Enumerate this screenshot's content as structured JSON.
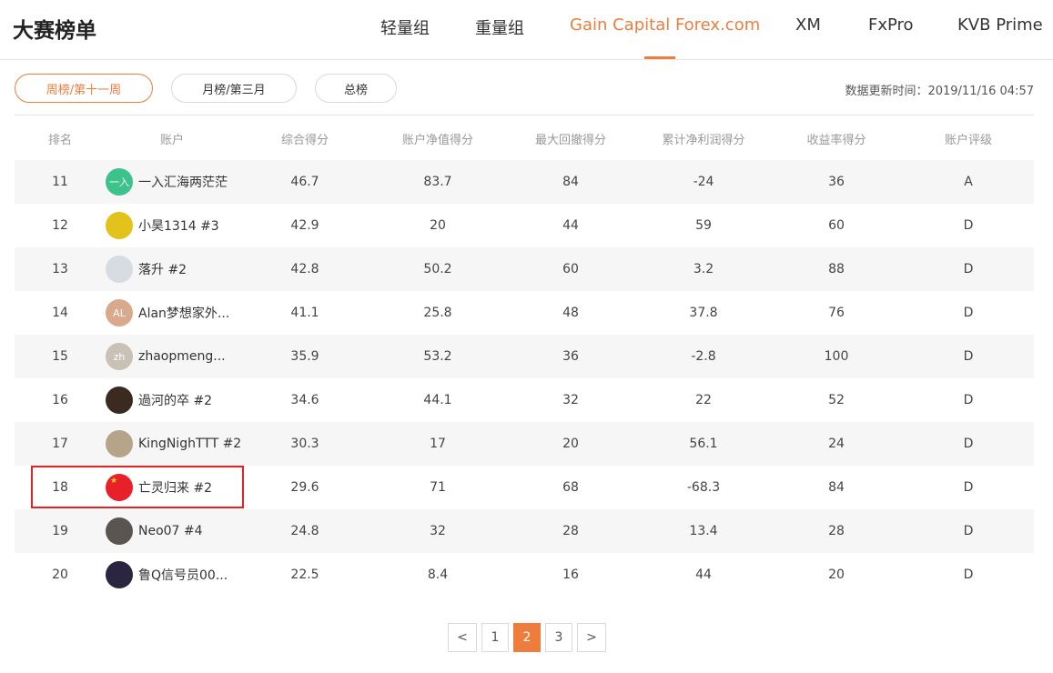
{
  "header": {
    "title": "大赛榜单",
    "tabs": [
      {
        "label": "轻量组",
        "active": false
      },
      {
        "label": "重量组",
        "active": false
      },
      {
        "label": "Gain Capital Forex.com",
        "active": true
      },
      {
        "label": "XM",
        "active": false
      },
      {
        "label": "FxPro",
        "active": false
      },
      {
        "label": "KVB Prime",
        "active": false
      }
    ]
  },
  "filters": [
    {
      "label": "周榜/第十一周",
      "active": true
    },
    {
      "label": "月榜/第三月",
      "active": false
    },
    {
      "label": "总榜",
      "active": false
    }
  ],
  "update_time": "数据更新时间：2019/11/16 04:57",
  "table": {
    "columns": [
      "排名",
      "账户",
      "综合得分",
      "账户净值得分",
      "最大回撤得分",
      "累计净利润得分",
      "收益率得分",
      "账户评级"
    ],
    "rows": [
      {
        "rank": "11",
        "avatar_text": "一入",
        "avatar_color": "#3cc28b",
        "name": "一入汇海两茫茫",
        "total": "46.7",
        "equity": "83.7",
        "drawdown": "84",
        "profit": "-24",
        "return": "36",
        "rating": "A"
      },
      {
        "rank": "12",
        "avatar_text": "",
        "avatar_color": "#e2c21b",
        "name": "小昊1314 #3",
        "total": "42.9",
        "equity": "20",
        "drawdown": "44",
        "profit": "59",
        "return": "60",
        "rating": "D"
      },
      {
        "rank": "13",
        "avatar_text": "",
        "avatar_color": "#d7dbe2",
        "name": "落升 #2",
        "total": "42.8",
        "equity": "50.2",
        "drawdown": "60",
        "profit": "3.2",
        "return": "88",
        "rating": "D"
      },
      {
        "rank": "14",
        "avatar_text": "AL",
        "avatar_color": "#d8a98c",
        "name": "Alan梦想家外...",
        "total": "41.1",
        "equity": "25.8",
        "drawdown": "48",
        "profit": "37.8",
        "return": "76",
        "rating": "D"
      },
      {
        "rank": "15",
        "avatar_text": "zh",
        "avatar_color": "#c9c0b6",
        "name": "zhaopmeng...",
        "total": "35.9",
        "equity": "53.2",
        "drawdown": "36",
        "profit": "-2.8",
        "return": "100",
        "rating": "D"
      },
      {
        "rank": "16",
        "avatar_text": "",
        "avatar_color": "#3a2a20",
        "name": "過河的卒 #2",
        "total": "34.6",
        "equity": "44.1",
        "drawdown": "32",
        "profit": "22",
        "return": "52",
        "rating": "D"
      },
      {
        "rank": "17",
        "avatar_text": "",
        "avatar_color": "#b6a48a",
        "name": "KingNighTTT #2",
        "total": "30.3",
        "equity": "17",
        "drawdown": "20",
        "profit": "56.1",
        "return": "24",
        "rating": "D"
      },
      {
        "rank": "18",
        "avatar_text": "",
        "avatar_color": "#e8202a",
        "name": "亡灵归来 #2",
        "total": "29.6",
        "equity": "71",
        "drawdown": "68",
        "profit": "-68.3",
        "return": "84",
        "rating": "D"
      },
      {
        "rank": "19",
        "avatar_text": "",
        "avatar_color": "#5a5550",
        "name": "Neo07 #4",
        "total": "24.8",
        "equity": "32",
        "drawdown": "28",
        "profit": "13.4",
        "return": "28",
        "rating": "D"
      },
      {
        "rank": "20",
        "avatar_text": "",
        "avatar_color": "#2b2540",
        "name": "鲁Q信号员00...",
        "total": "22.5",
        "equity": "8.4",
        "drawdown": "16",
        "profit": "44",
        "return": "20",
        "rating": "D"
      }
    ]
  },
  "pagination": {
    "prev": "<",
    "pages": [
      "1",
      "2",
      "3"
    ],
    "current": "2",
    "next": ">"
  },
  "colors": {
    "accent": "#ee7c3c",
    "highlight_border": "#e02424"
  }
}
